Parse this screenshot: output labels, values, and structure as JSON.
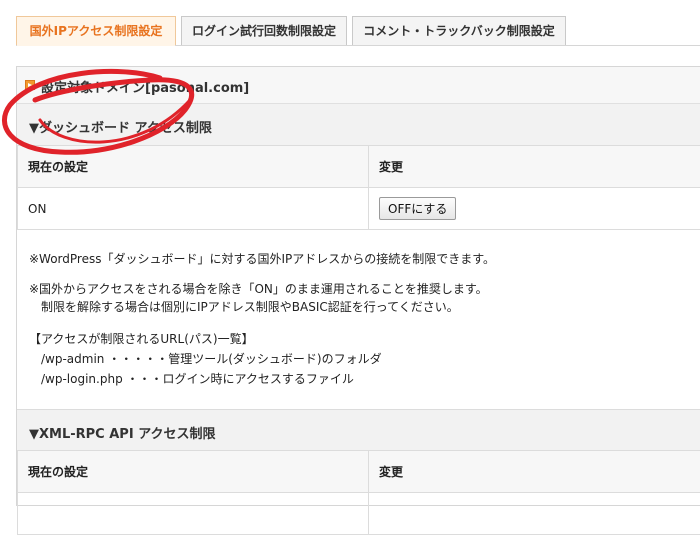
{
  "tabs": [
    {
      "label": "国外IPアクセス制限設定",
      "active": true
    },
    {
      "label": "ログイン試行回数制限設定",
      "active": false
    },
    {
      "label": "コメント・トラックバック制限設定",
      "active": false
    }
  ],
  "domain_label": "設定対象ドメイン[pasonal.com]",
  "dashboard": {
    "title": "▼ダッシュボード アクセス制限",
    "col_current": "現在の設定",
    "col_change": "変更",
    "current_value": "ON",
    "button_label": "OFFにする",
    "notes": [
      "※WordPress「ダッシュボード」に対する国外IPアドレスからの接続を制限できます。",
      "※国外からアクセスをされる場合を除き「ON」のまま運用されることを推奨します。",
      "　制限を解除する場合は個別にIPアドレス制限やBASIC認証を行ってください。",
      "【アクセスが制限されるURL(パス)一覧】",
      "　/wp-admin ・・・・・管理ツール(ダッシュボード)のフォルダ",
      "　/wp-login.php ・・・ログイン時にアクセスするファイル"
    ]
  },
  "xmlrpc": {
    "title": "▼XML-RPC API アクセス制限",
    "col_current": "現在の設定",
    "col_change": "変更"
  },
  "colors": {
    "accent": "#e8731f",
    "annotation": "#e0232a"
  }
}
